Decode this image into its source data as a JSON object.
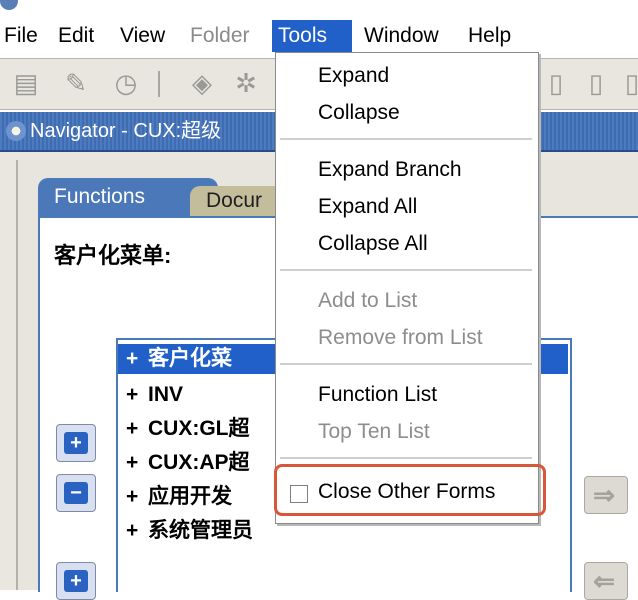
{
  "menubar": {
    "items": [
      {
        "label": "File",
        "state": "normal"
      },
      {
        "label": "Edit",
        "state": "normal"
      },
      {
        "label": "View",
        "state": "normal"
      },
      {
        "label": "Folder",
        "state": "disabled"
      },
      {
        "label": "Tools",
        "state": "active"
      },
      {
        "label": "Window",
        "state": "normal"
      },
      {
        "label": "Help",
        "state": "normal"
      }
    ]
  },
  "toolbar": {
    "icons": [
      "new-record-icon",
      "find-icon",
      "history-icon",
      "separator",
      "edit-icon",
      "attachment-icon",
      "folder-icon",
      "multi-folder-icon"
    ]
  },
  "navigator": {
    "title": "Navigator - CUX:超级"
  },
  "tabs": [
    {
      "label": "Functions",
      "active": true
    },
    {
      "label": "Docur",
      "active": false
    }
  ],
  "panel": {
    "menu_label": "客户化菜单:"
  },
  "function_list": [
    {
      "prefix": "+",
      "label": "客户化菜",
      "selected": true
    },
    {
      "prefix": "+",
      "label": "INV",
      "selected": false
    },
    {
      "prefix": "+",
      "label": "CUX:GL超",
      "selected": false
    },
    {
      "prefix": "+",
      "label": "CUX:AP超",
      "selected": false
    },
    {
      "prefix": "+",
      "label": "应用开发",
      "selected": false
    },
    {
      "prefix": "+",
      "label": "系统管理员",
      "selected": false
    }
  ],
  "tools_menu": {
    "items": [
      {
        "label": "Expand",
        "enabled": true
      },
      {
        "label": "Collapse",
        "enabled": true
      },
      {
        "label": "Expand Branch",
        "enabled": true
      },
      {
        "label": "Expand All",
        "enabled": true
      },
      {
        "label": "Collapse All",
        "enabled": true
      },
      {
        "label": "Add to List",
        "enabled": false
      },
      {
        "label": "Remove from List",
        "enabled": false
      },
      {
        "label": "Function List",
        "enabled": true
      },
      {
        "label": "Top Ten List",
        "enabled": false
      },
      {
        "label": "Close Other Forms",
        "enabled": true,
        "checkbox": true,
        "checked": false,
        "highlighted": true
      }
    ]
  },
  "colors": {
    "accent": "#2060c8",
    "highlight_border": "#d8563a"
  }
}
